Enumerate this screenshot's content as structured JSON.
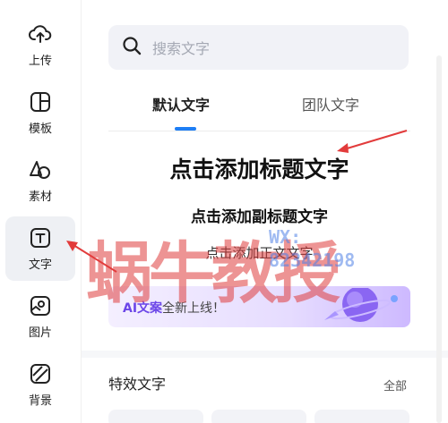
{
  "sidebar": {
    "items": [
      {
        "label": "上传",
        "icon": "upload-cloud-icon"
      },
      {
        "label": "模板",
        "icon": "template-icon"
      },
      {
        "label": "素材",
        "icon": "shapes-icon"
      },
      {
        "label": "文字",
        "icon": "text-icon",
        "active": true
      },
      {
        "label": "图片",
        "icon": "image-icon"
      },
      {
        "label": "背景",
        "icon": "background-icon"
      }
    ]
  },
  "search": {
    "placeholder": "搜索文字",
    "icon": "search-icon"
  },
  "tabs": [
    {
      "label": "默认文字",
      "active": true
    },
    {
      "label": "团队文字",
      "active": false
    }
  ],
  "text_presets": {
    "heading": "点击添加标题文字",
    "subheading": "点击添加副标题文字",
    "body": "点击添加正文文字"
  },
  "banner": {
    "ai": "AI文案",
    "rest": "全新上线！"
  },
  "effects": {
    "title": "特效文字",
    "all": "全部"
  },
  "watermark": {
    "big": "蜗牛教授",
    "wx": "WX:",
    "number": "82342198"
  },
  "colors": {
    "accent": "#1e7ef5",
    "active_bg": "#eef0f4",
    "arrow": "#e23b3b",
    "banner_ai": "#6b46e8"
  }
}
